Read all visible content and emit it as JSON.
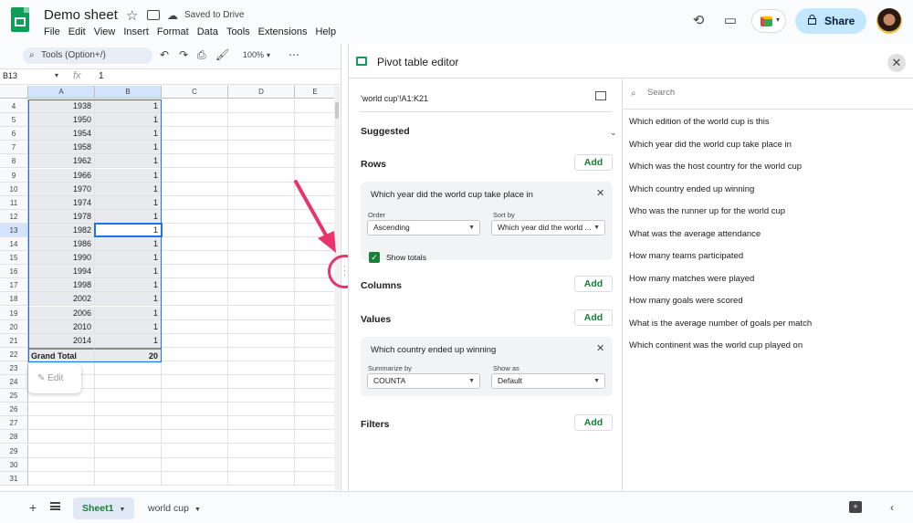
{
  "app": {
    "title": "Demo sheet",
    "save_status": "Saved to Drive",
    "menu": [
      "File",
      "Edit",
      "View",
      "Insert",
      "Format",
      "Data",
      "Tools",
      "Extensions",
      "Help"
    ],
    "share_label": "Share",
    "icons": {
      "logo": "sheets-logo",
      "star": "star-icon",
      "move": "folder-move-icon",
      "cloud": "cloud-done-icon",
      "history": "history-icon",
      "comments": "comment-icon",
      "meet": "meet-icon"
    }
  },
  "toolbar": {
    "search_placeholder": "Tools (Option+/)",
    "zoom": "100%",
    "more": "⋯"
  },
  "formula_bar": {
    "cell_ref": "B13",
    "fx": "fx",
    "value": "1"
  },
  "grid": {
    "columns": [
      "A",
      "B",
      "C",
      "D",
      "E"
    ],
    "rows": [
      {
        "n": "4",
        "a": "1938",
        "b": "1"
      },
      {
        "n": "5",
        "a": "1950",
        "b": "1"
      },
      {
        "n": "6",
        "a": "1954",
        "b": "1"
      },
      {
        "n": "7",
        "a": "1958",
        "b": "1"
      },
      {
        "n": "8",
        "a": "1962",
        "b": "1"
      },
      {
        "n": "9",
        "a": "1966",
        "b": "1"
      },
      {
        "n": "10",
        "a": "1970",
        "b": "1"
      },
      {
        "n": "11",
        "a": "1974",
        "b": "1"
      },
      {
        "n": "12",
        "a": "1978",
        "b": "1"
      },
      {
        "n": "13",
        "a": "1982",
        "b": "1"
      },
      {
        "n": "14",
        "a": "1986",
        "b": "1"
      },
      {
        "n": "15",
        "a": "1990",
        "b": "1"
      },
      {
        "n": "16",
        "a": "1994",
        "b": "1"
      },
      {
        "n": "17",
        "a": "1998",
        "b": "1"
      },
      {
        "n": "18",
        "a": "2002",
        "b": "1"
      },
      {
        "n": "19",
        "a": "2006",
        "b": "1"
      },
      {
        "n": "20",
        "a": "2010",
        "b": "1"
      },
      {
        "n": "21",
        "a": "2014",
        "b": "1"
      },
      {
        "n": "22",
        "a": "Grand Total",
        "b": "20"
      },
      {
        "n": "23",
        "a": "",
        "b": ""
      },
      {
        "n": "24",
        "a": "",
        "b": ""
      },
      {
        "n": "25",
        "a": "",
        "b": ""
      },
      {
        "n": "26",
        "a": "",
        "b": ""
      },
      {
        "n": "27",
        "a": "",
        "b": ""
      },
      {
        "n": "28",
        "a": "",
        "b": ""
      },
      {
        "n": "29",
        "a": "",
        "b": ""
      },
      {
        "n": "30",
        "a": "",
        "b": ""
      },
      {
        "n": "31",
        "a": "",
        "b": ""
      }
    ],
    "edit_chip": "Edit"
  },
  "pivot_editor": {
    "title": "Pivot table editor",
    "range": "'world cup'!A1:K21",
    "suggested": "Suggested",
    "rows_label": "Rows",
    "columns_label": "Columns",
    "values_label": "Values",
    "filters_label": "Filters",
    "add": "Add",
    "row_card": {
      "title": "Which year did the world cup take place in",
      "order_label": "Order",
      "order_value": "Ascending",
      "sort_label": "Sort by",
      "sort_value": "Which year did the world ...",
      "show_totals": "Show totals",
      "show_totals_checked": true
    },
    "value_card": {
      "title": "Which country ended up winning",
      "summarize_label": "Summarize by",
      "summarize_value": "COUNTA",
      "showas_label": "Show as",
      "showas_value": "Default"
    },
    "search_placeholder": "Search",
    "fields": [
      "Which edition of the world cup is this",
      "Which year did the world cup take place in",
      "Which was the host country for the world cup",
      "Which country ended up winning",
      "Who was the runner up for the world cup",
      "What was the average attendance",
      "How many teams participated",
      "How many matches were played",
      "How many goals were scored",
      "What is the average number of goals per match",
      "Which continent was the world cup played on"
    ]
  },
  "sheets": {
    "tabs": [
      {
        "label": "Sheet1",
        "active": true
      },
      {
        "label": "world cup",
        "active": false
      }
    ]
  },
  "colors": {
    "accent_green": "#188038",
    "selection_blue": "#1a73e8",
    "share_bg": "#c2e7ff",
    "annotation_pink": "#e8336d"
  }
}
